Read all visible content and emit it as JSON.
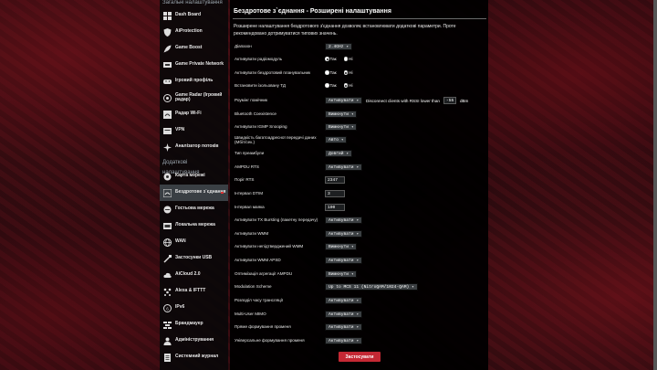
{
  "sidebar": {
    "general_title": "Загальні налаштування",
    "advanced_title": "Додаткові налаштування",
    "general": [
      {
        "label": "Dash Board",
        "icon": "dashboard-icon"
      },
      {
        "label": "AiProtection",
        "icon": "shield-icon"
      },
      {
        "label": "Game Boost",
        "icon": "rocket-icon"
      },
      {
        "label": "Game Private Network",
        "icon": "network-icon"
      },
      {
        "label": "Ігровий профіль",
        "icon": "gamepad-icon"
      },
      {
        "label": "Game Radar (Ігровий радар)",
        "icon": "radar-icon"
      },
      {
        "label": "Радар Wi-Fi",
        "icon": "wifi-radar-icon"
      },
      {
        "label": "VPN",
        "icon": "vpn-icon"
      },
      {
        "label": "Аналізатор потоків",
        "icon": "analyzer-icon"
      }
    ],
    "advanced": [
      {
        "label": "Карта мережі",
        "icon": "globe-icon"
      },
      {
        "label": "Бездротове з`єднання",
        "icon": "wireless-icon",
        "active": true
      },
      {
        "label": "Гостьова мережа",
        "icon": "guest-icon"
      },
      {
        "label": "Локальна мережа",
        "icon": "lan-icon"
      },
      {
        "label": "WAN",
        "icon": "wan-globe-icon"
      },
      {
        "label": "Застосунки USB",
        "icon": "usb-icon"
      },
      {
        "label": "AiCloud 2.0",
        "icon": "cloud-icon"
      },
      {
        "label": "Alexa & IFTTT",
        "icon": "alexa-icon"
      },
      {
        "label": "IPv6",
        "icon": "ipv6-icon"
      },
      {
        "label": "Брандмауер",
        "icon": "firewall-icon"
      },
      {
        "label": "Адміністрування",
        "icon": "admin-icon"
      },
      {
        "label": "Системний журнал",
        "icon": "log-icon"
      }
    ]
  },
  "main": {
    "title": "Бездротове з`єднання - Розширені налаштування",
    "description": "Розширене налаштування бездротового з'єднання дозволяє встановлювати додаткові параметри. Проте рекомендовано дотримуватися типових значень.",
    "radio_yes": "Так",
    "radio_no": "Ні",
    "rows": {
      "band": {
        "label": "Діапазон",
        "value": "2.4GHz"
      },
      "radio_enable": {
        "label": "Активувати радіомодуль",
        "selected": "yes"
      },
      "wireless_schedule": {
        "label": "Активувати бездротовий планувальник",
        "selected": "yes"
      },
      "ap_isolated": {
        "label": "Встановити ізольовану ТД",
        "selected": "yes"
      },
      "roaming": {
        "label": "Роумінг помічник",
        "value": "Активувати",
        "text": "Disconnect clients with RSSI lower than",
        "rssi": "-55",
        "unit": "dBm"
      },
      "bt_coexistence": {
        "label": "Bluetooth Coexistence",
        "value": "Вимкнути"
      },
      "igmp": {
        "label": "Активувати IGMP Snooping",
        "value": "Вимкнути"
      },
      "multicast_rate": {
        "label": "Швидкість багатоадресної передачі даних (Мбіт/сек.)",
        "value": "Авто"
      },
      "preamble": {
        "label": "Тип преамбули",
        "value": "Довгий"
      },
      "ampdu_rts": {
        "label": "AMPDU RTS",
        "value": "Активувати"
      },
      "rts_threshold": {
        "label": "Поріг RTS",
        "value": "2347"
      },
      "dtim": {
        "label": "Інтервал DTIM",
        "value": "3"
      },
      "beacon": {
        "label": "Інтервал маяка",
        "value": "100"
      },
      "tx_bursting": {
        "label": "Активувати TX Bursting (пакетну передачу)",
        "value": "Активувати"
      },
      "wmm": {
        "label": "Активувати WMM",
        "value": "Активувати"
      },
      "wmm_noack": {
        "label": "Активувати непідтверджений WMM",
        "value": "Вимкнути"
      },
      "wmm_apsd": {
        "label": "Активувати WMM APSD",
        "value": "Активувати"
      },
      "ampdu_agg": {
        "label": "Оптимізація агрегації AMPDU",
        "value": "Вимкнути"
      },
      "modulation": {
        "label": "Modulation Scheme",
        "value": "Up to MCS 11 (NitroQAM/1024-QAM)"
      },
      "airtime": {
        "label": "Розподіл часу трансляції",
        "value": "Активувати"
      },
      "mu_mimo": {
        "label": "Multi-User MIMO",
        "value": "Активувати"
      },
      "explicit_bf": {
        "label": "Пряме формування променя",
        "value": "Активувати"
      },
      "universal_bf": {
        "label": "Універсальне формування променя",
        "value": "Активувати"
      }
    },
    "apply_label": "Застосувати"
  }
}
